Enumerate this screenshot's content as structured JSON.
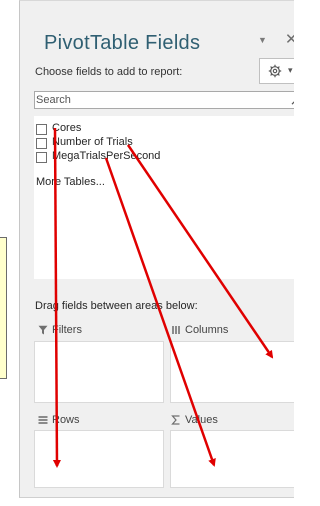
{
  "pane": {
    "title": "PivotTable Fields",
    "subtitle": "Choose fields to add to report:",
    "search": {
      "placeholder": "Search"
    },
    "fields": [
      {
        "label": "Cores",
        "checked": false
      },
      {
        "label": "Number of Trials",
        "checked": false
      },
      {
        "label": "MegaTrialsPerSecond",
        "checked": false
      }
    ],
    "more_tables": "More Tables...",
    "drag_instruction": "Drag fields between areas below:",
    "areas": {
      "filters": "Filters",
      "columns": "Columns",
      "rows": "Rows",
      "values": "Values"
    }
  },
  "icons": {
    "dropdown": "chevron-down-icon",
    "close": "close-icon",
    "tools": "gear-icon",
    "search": "search-icon",
    "filters": "filter-icon",
    "columns": "columns-icon",
    "rows": "rows-icon",
    "values": "sigma-icon"
  },
  "colors": {
    "title": "#2f5f72",
    "pane_background": "#f0f0f0",
    "annotation_arrows": "#e00000",
    "note_background": "#ffffcc"
  }
}
